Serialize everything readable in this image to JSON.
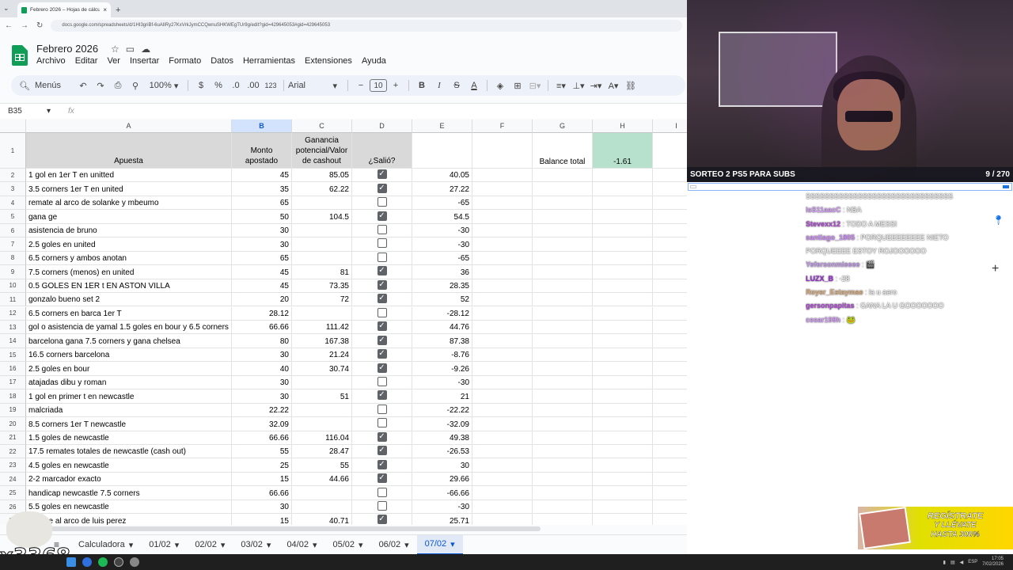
{
  "browser": {
    "tab_title": "Febrero 2026 – Hojas de cálculo",
    "url": "docs.google.com/spreadsheets/d/1HI3griBf-6uAlIRy27KxVrkJymCCQwnuSHKWEgTUr9g/edit?gid=429645053#gid=429645053"
  },
  "doc": {
    "title": "Febrero 2026",
    "menu": [
      "Archivo",
      "Editar",
      "Ver",
      "Insertar",
      "Formato",
      "Datos",
      "Herramientas",
      "Extensiones",
      "Ayuda"
    ]
  },
  "toolbar": {
    "search": "Menús",
    "zoom": "100%",
    "currency": "$",
    "percent": "%",
    "dec_less": ".0",
    "dec_more": ".00",
    "num_format": "123",
    "font": "Arial",
    "font_size": "10"
  },
  "formula": {
    "cell_ref": "B35",
    "fx": "fx"
  },
  "columns": [
    "A",
    "B",
    "C",
    "D",
    "E",
    "F",
    "G",
    "H",
    "I"
  ],
  "header": {
    "a": "Apuesta",
    "b": "Monto apostado",
    "c": "Ganancia potencial/Valor de cashout",
    "d": "¿Salió?",
    "g": "Balance total",
    "h": "-1.61"
  },
  "rows": [
    {
      "n": "2",
      "a": "1 gol en 1er T en unitted",
      "b": "45",
      "c": "85.05",
      "d": true,
      "e": "40.05"
    },
    {
      "n": "3",
      "a": "3.5 corners 1er T en united",
      "b": "35",
      "c": "62.22",
      "d": true,
      "e": "27.22"
    },
    {
      "n": "4",
      "a": "remate al arco de solanke y mbeumo",
      "b": "65",
      "c": "",
      "d": false,
      "e": "-65"
    },
    {
      "n": "5",
      "a": "gana ge",
      "b": "50",
      "c": "104.5",
      "d": true,
      "e": "54.5"
    },
    {
      "n": "6",
      "a": "asistencia de bruno",
      "b": "30",
      "c": "",
      "d": false,
      "e": "-30"
    },
    {
      "n": "7",
      "a": "2.5 goles en united",
      "b": "30",
      "c": "",
      "d": false,
      "e": "-30"
    },
    {
      "n": "8",
      "a": "6.5 corners y ambos anotan",
      "b": "65",
      "c": "",
      "d": false,
      "e": "-65"
    },
    {
      "n": "9",
      "a": "7.5 corners (menos) en united",
      "b": "45",
      "c": "81",
      "d": true,
      "e": "36"
    },
    {
      "n": "10",
      "a": "0.5 GOLES EN 1ER t EN ASTON VILLA",
      "b": "45",
      "c": "73.35",
      "d": true,
      "e": "28.35"
    },
    {
      "n": "11",
      "a": "gonzalo bueno set 2",
      "b": "20",
      "c": "72",
      "d": true,
      "e": "52"
    },
    {
      "n": "12",
      "a": "6.5 corners en barca 1er T",
      "b": "28.12",
      "c": "",
      "d": false,
      "e": "-28.12"
    },
    {
      "n": "13",
      "a": "gol o asistencia de yamal 1.5 goles en bour y 6.5 corners",
      "b": "66.66",
      "c": "111.42",
      "d": true,
      "e": "44.76"
    },
    {
      "n": "14",
      "a": "barcelona gana 7.5 corners y gana chelsea",
      "b": "80",
      "c": "167.38",
      "d": true,
      "e": "87.38"
    },
    {
      "n": "15",
      "a": "16.5 corners barcelona",
      "b": "30",
      "c": "21.24",
      "d": true,
      "e": "-8.76"
    },
    {
      "n": "16",
      "a": "2.5 goles en bour",
      "b": "40",
      "c": "30.74",
      "d": true,
      "e": "-9.26"
    },
    {
      "n": "17",
      "a": "atajadas dibu y roman",
      "b": "30",
      "c": "",
      "d": false,
      "e": "-30"
    },
    {
      "n": "18",
      "a": "1 gol en primer t en newcastle",
      "b": "30",
      "c": "51",
      "d": true,
      "e": "21"
    },
    {
      "n": "19",
      "a": "malcriada",
      "b": "22.22",
      "c": "",
      "d": false,
      "e": "-22.22"
    },
    {
      "n": "20",
      "a": "8.5 corners 1er T newcastle",
      "b": "32.09",
      "c": "",
      "d": false,
      "e": "-32.09"
    },
    {
      "n": "21",
      "a": "1.5 goles de newcastle",
      "b": "66.66",
      "c": "116.04",
      "d": true,
      "e": "49.38"
    },
    {
      "n": "22",
      "a": "17.5 remates totales de newcastle (cash out)",
      "b": "55",
      "c": "28.47",
      "d": true,
      "e": "-26.53"
    },
    {
      "n": "23",
      "a": "4.5 goles en newcastle",
      "b": "25",
      "c": "55",
      "d": true,
      "e": "30"
    },
    {
      "n": "24",
      "a": "2-2 marcador exacto",
      "b": "15",
      "c": "44.66",
      "d": true,
      "e": "29.66"
    },
    {
      "n": "25",
      "a": "handicap newcastle 7.5 corners",
      "b": "66.66",
      "c": "",
      "d": false,
      "e": "-66.66"
    },
    {
      "n": "26",
      "a": "5.5 goles en newcastle",
      "b": "30",
      "c": "",
      "d": false,
      "e": "-30"
    },
    {
      "n": "27",
      "a": "remate al arco de luis perez",
      "b": "15",
      "c": "40.71",
      "d": true,
      "e": "25.71"
    }
  ],
  "sheet_tabs": [
    "Calculadora",
    "01/02",
    "02/02",
    "03/02",
    "04/02",
    "05/02",
    "06/02",
    "07/02"
  ],
  "stream": {
    "giveaway": "SORTEO 2 PS5 PARA SUBS",
    "counter": "9 / 270"
  },
  "chat": [
    {
      "u": "",
      "m": "SSSSSSSSSSSSSSSSSSSSSSSSSSSSSSS",
      "c": "#fff"
    },
    {
      "u": "IsS11aacC",
      "m": " : NBA",
      "c": "#d9a0ff"
    },
    {
      "u": "Stevexx12",
      "m": " : TODO A MESSI",
      "c": "#b24bd6"
    },
    {
      "u": "santiago_1805",
      "m": " : PORQUEEEEEEEE NIETO PORQUEEEE ESTOY ROJOOOOOO",
      "c": "#d28fff"
    },
    {
      "u": "Yefersonmieeee",
      "m": " : 🎬",
      "c": "#c7a0f0"
    },
    {
      "u": "LUZX_B",
      "m": " : -28",
      "c": "#9b2fd6"
    },
    {
      "u": "Royer_Estaymae",
      "m": " : la u aero",
      "c": "#e0b080"
    },
    {
      "u": "gersonpapitas",
      "m": " : GANA LA U GOOOOOOO",
      "c": "#b24bd6"
    },
    {
      "u": "cesar199h",
      "m": " : 🐸",
      "c": "#d9a0ff"
    }
  ],
  "promo": {
    "line1": "REGÍSTRATE",
    "line2": "Y LLÉVATE",
    "line3": "HASTA 300%"
  },
  "overlay_text": "x3368",
  "taskbar": {
    "lang": "ESP",
    "time": "17:05",
    "date": "7/02/2026"
  }
}
